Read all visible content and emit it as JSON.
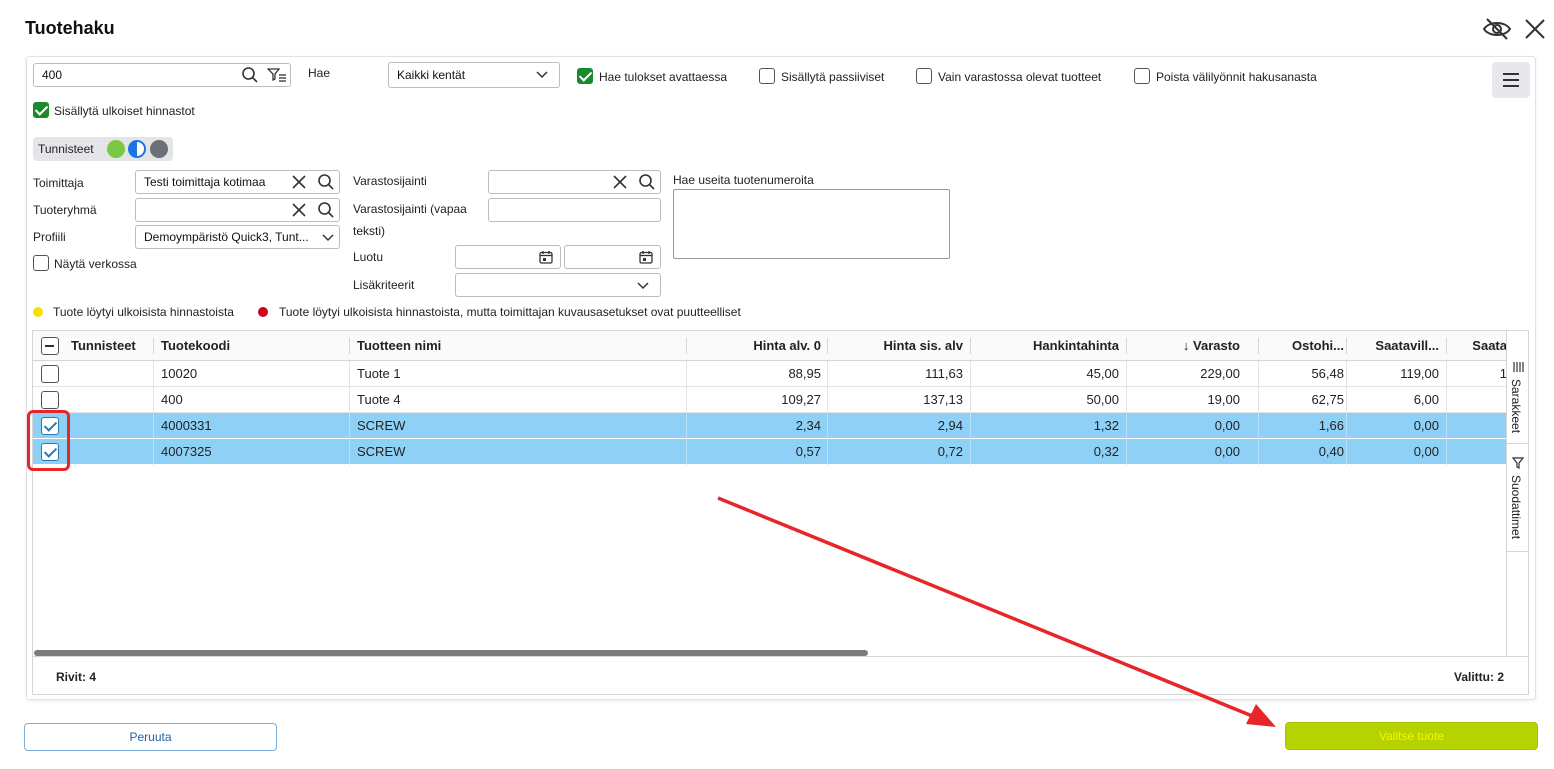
{
  "dialog": {
    "title": "Tuotehaku"
  },
  "search": {
    "value": "400",
    "hae_label": "Hae",
    "field_select": "Kaikki kentät",
    "options": [
      {
        "label": "Hae tulokset avattaessa",
        "checked": true
      },
      {
        "label": "Sisällytä passiiviset",
        "checked": false
      },
      {
        "label": "Vain varastossa olevat tuotteet",
        "checked": false
      },
      {
        "label": "Poista välilyönnit hakusanasta",
        "checked": false
      }
    ],
    "include_external": {
      "label": "Sisällytä ulkoiset hinnastot",
      "checked": true
    }
  },
  "tags": {
    "label": "Tunnisteet",
    "colors": [
      "#7ac943",
      "#1a73e8",
      "#6b6f76"
    ]
  },
  "filters": {
    "supplier_label": "Toimittaja",
    "supplier_value": "Testi toimittaja kotimaa",
    "group_label": "Tuoteryhmä",
    "group_value": "",
    "profile_label": "Profiili",
    "profile_value": "Demoympäristö Quick3, Tunt...",
    "show_web_label": "Näytä verkossa",
    "location_label": "Varastosijainti",
    "location_free_label_1": "Varastosijainti (vapaa",
    "location_free_label_2": "teksti)",
    "created_label": "Luotu",
    "extra_label": "Lisäkriteerit",
    "multi_label": "Hae useita tuotenumeroita"
  },
  "legend": {
    "yellow": "Tuote löytyi ulkoisista hinnastoista",
    "red": "Tuote löytyi ulkoisista hinnastoista, mutta toimittajan kuvausasetukset ovat puutteelliset",
    "yellow_color": "#f5e000",
    "red_color": "#d0021b"
  },
  "table": {
    "columns": [
      "Tunnisteet",
      "Tuotekoodi",
      "Tuotteen nimi",
      "Hinta alv. 0",
      "Hinta sis. alv",
      "Hankintahinta",
      "↓ Varasto",
      "Ostohi...",
      "Saatavill...",
      "Saata"
    ],
    "rows": [
      {
        "selected": false,
        "cells": [
          "10020",
          "Tuote 1",
          "88,95",
          "111,63",
          "45,00",
          "229,00",
          "56,48",
          "119,00",
          "1"
        ]
      },
      {
        "selected": false,
        "cells": [
          "400",
          "Tuote 4",
          "109,27",
          "137,13",
          "50,00",
          "19,00",
          "62,75",
          "6,00",
          ""
        ]
      },
      {
        "selected": true,
        "cells": [
          "4000331",
          "SCREW",
          "2,34",
          "2,94",
          "1,32",
          "0,00",
          "1,66",
          "0,00",
          ""
        ]
      },
      {
        "selected": true,
        "cells": [
          "4007325",
          "SCREW",
          "0,57",
          "0,72",
          "0,32",
          "0,00",
          "0,40",
          "0,00",
          ""
        ]
      }
    ],
    "side_columns": "Sarakkeet",
    "side_filters": "Suodattimet",
    "rows_label": "Rivit",
    "rows_count": "4",
    "selected_label": "Valittu",
    "selected_count": "2"
  },
  "buttons": {
    "cancel": "Peruuta",
    "select": "Valitse tuote"
  },
  "colors": {
    "select_bg": "#b5d300",
    "select_text": "#f5f500",
    "highlight": "#e8262a",
    "row_selected": "#8fd0f7"
  }
}
